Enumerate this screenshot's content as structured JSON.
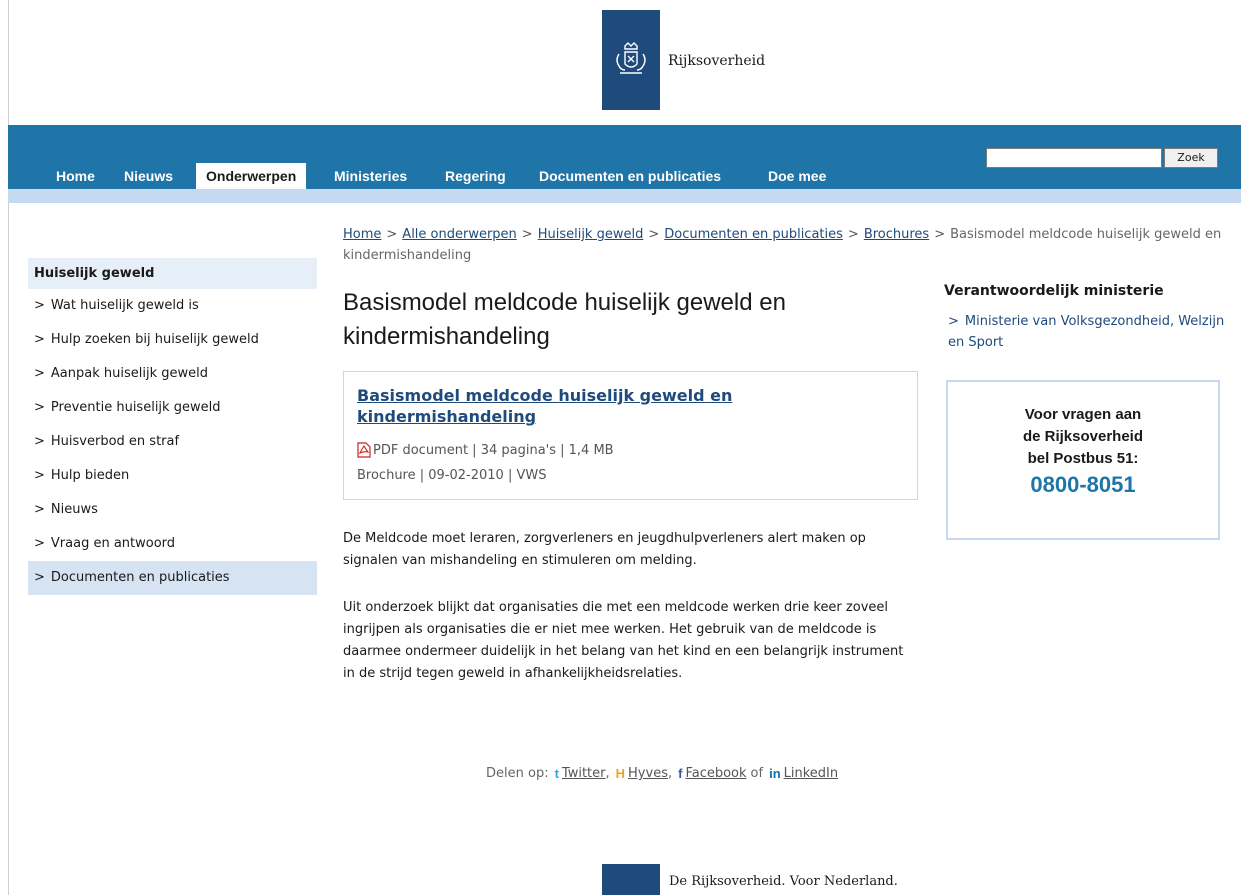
{
  "header": {
    "logo_text": "Rijksoverheid"
  },
  "nav": {
    "items": [
      "Home",
      "Nieuws",
      "Onderwerpen",
      "Ministeries",
      "Regering",
      "Documenten en publicaties",
      "Doe mee"
    ],
    "active": "Onderwerpen",
    "search_button": "Zoek",
    "search_value": ""
  },
  "breadcrumb": {
    "links": [
      "Home",
      "Alle onderwerpen",
      "Huiselijk geweld",
      "Documenten en publicaties",
      "Brochures"
    ],
    "separator": ">",
    "current": "Basismodel meldcode huiselijk geweld en kindermishandeling"
  },
  "sidebar": {
    "title": "Huiselijk geweld",
    "items": [
      "Wat huiselijk geweld is",
      "Hulp zoeken bij huiselijk geweld",
      "Aanpak huiselijk geweld",
      "Preventie huiselijk geweld",
      "Huisverbod en straf",
      "Hulp bieden",
      "Nieuws",
      "Vraag en antwoord",
      "Documenten en publicaties"
    ],
    "active_item": "Documenten en publicaties",
    "chevron": ">"
  },
  "main": {
    "title": "Basismodel meldcode huiselijk geweld en kindermishandeling",
    "document": {
      "link": "Basismodel meldcode huiselijk geweld en kindermishandeling",
      "meta1": "PDF document | 34 pagina's | 1,4 MB",
      "meta2": "Brochure | 09-02-2010 | VWS",
      "icon": "pdf-icon"
    },
    "paragraphs": [
      "De Meldcode moet leraren, zorgverleners en jeugdhulpverleners alert maken op signalen van mishandeling en stimuleren om melding.",
      "Uit onderzoek blijkt dat organisaties die met een meldcode werken drie keer zoveel ingrijpen als organisaties die er niet mee werken. Het gebruik van de meldcode is daarmee ondermeer duidelijk in het belang van het kind en een belangrijk instrument in de strijd tegen geweld in afhankelijkheidsrelaties."
    ],
    "share": {
      "prefix": "Delen op:",
      "twitter": "Twitter",
      "hyves": "Hyves",
      "facebook": "Facebook",
      "or": "of",
      "linkedin": "LinkedIn",
      "sep": ","
    }
  },
  "right": {
    "title": "Verantwoordelijk ministerie",
    "link": "Ministerie van Volksgezondheid, Welzijn en Sport",
    "contact": {
      "line1": "Voor vragen aan",
      "line2": "de Rijksoverheid",
      "line3": "bel Postbus 51:",
      "phone": "0800-8051"
    }
  },
  "footer": {
    "text": "De Rijksoverheid. Voor Nederland."
  },
  "colors": {
    "nav_blue": "#1f74a8",
    "logo_blue": "#1f4a7c",
    "light_blue": "#c5daf0"
  }
}
